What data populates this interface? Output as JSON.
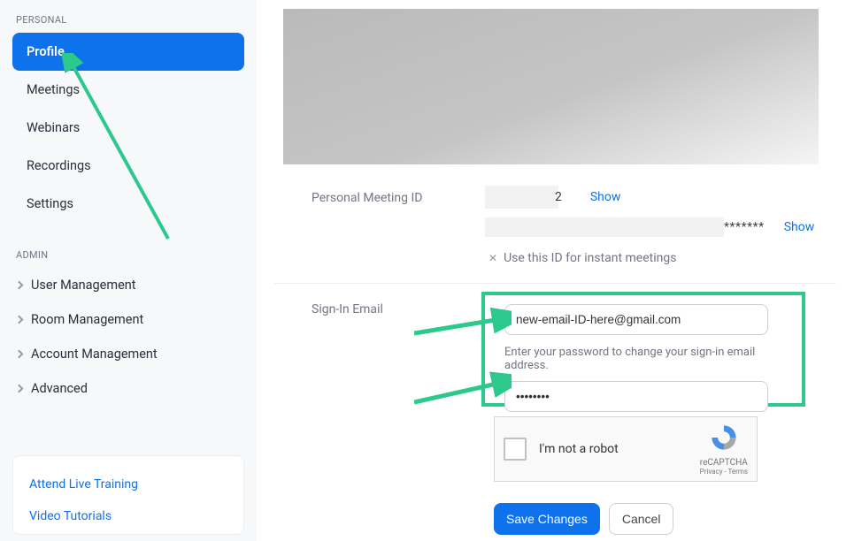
{
  "sidebar": {
    "personal_label": "PERSONAL",
    "items": [
      {
        "label": "Profile"
      },
      {
        "label": "Meetings"
      },
      {
        "label": "Webinars"
      },
      {
        "label": "Recordings"
      },
      {
        "label": "Settings"
      }
    ],
    "admin_label": "ADMIN",
    "admin_items": [
      {
        "label": "User Management"
      },
      {
        "label": "Room Management"
      },
      {
        "label": "Account Management"
      },
      {
        "label": "Advanced"
      }
    ],
    "links": [
      {
        "label": "Attend Live Training"
      },
      {
        "label": "Video Tutorials"
      }
    ]
  },
  "main": {
    "pmi_label": "Personal Meeting ID",
    "pmi_digit": "2",
    "show_label": "Show",
    "url_dots": "*******",
    "show_label2": "Show",
    "instant_text": "Use this ID for instant meetings",
    "signin_label": "Sign-In Email",
    "email_value": "new-email-ID-here@gmail.com",
    "password_value": "••••••••",
    "help_text": "Enter your password to change your sign-in email address.",
    "recaptcha": {
      "label": "I'm not a robot",
      "badge": "reCAPTCHA",
      "terms": "Privacy - Terms"
    },
    "save_label": "Save Changes",
    "cancel_label": "Cancel"
  }
}
